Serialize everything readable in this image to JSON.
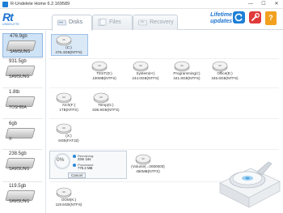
{
  "window": {
    "title": "R-Undelete Home 6.2.169589",
    "minimize": "—",
    "maximize": "☐",
    "close": "✕"
  },
  "header": {
    "logo": "R",
    "logo_sub": "UNDELETE",
    "tabs": [
      {
        "label": "Disks"
      },
      {
        "label": "Files"
      },
      {
        "label": "Recovery"
      }
    ],
    "lifetime_line1": "Lifetime",
    "lifetime_line2": "updates",
    "help": "?"
  },
  "drives": [
    {
      "size": "476.9gb",
      "name": "SAMSUNG"
    },
    {
      "size": "931.5gb",
      "name": "SAMSUNG"
    },
    {
      "size": "1.8tb",
      "name": "TOSHIBA"
    },
    {
      "size": "6gb",
      "name": "X:"
    },
    {
      "size": "238.5gb",
      "name": "SAMSUNG"
    },
    {
      "size": "119.5gb",
      "name": "SAMSUNG"
    }
  ],
  "partitions": {
    "row1": [
      {
        "line1": "(C:)",
        "line2": "476.4GB(NTFS)"
      }
    ],
    "row2": [
      {
        "line1": "TEST(D:)",
        "line2": "100MB(NTFS)"
      },
      {
        "line1": "System(H:)",
        "line2": "244.0GB(NTFS)"
      },
      {
        "line1": "Programming(I:)",
        "line2": "341.8GB(NTFS)"
      },
      {
        "line1": "Office(E:)",
        "line2": "345.6GB(NTFS)"
      }
    ],
    "row3": [
      {
        "line1": "Arch(F:)",
        "line2": "1TB(NTFS)"
      },
      {
        "line1": "Temp(G:)",
        "line2": "838.9GB(NTFS)"
      }
    ],
    "row4": [
      {
        "line1": "(X:)",
        "line2": "6GB(FAT32)"
      }
    ],
    "row5": [
      {
        "line1": "(Volume{...0000000}",
        "line2": "450MB(NTFS)"
      }
    ],
    "row6": [
      {
        "line1": "OOM(K:)",
        "line2": "119.5GB(NTFS)"
      }
    ]
  },
  "progress": {
    "percent": "0%",
    "remaining_label": "Remaining:",
    "remaining_value": "33m 16s",
    "processed_label": "Processed:",
    "processed_value": "775.2 MB",
    "cancel": "Cancel"
  },
  "colors": {
    "accent": "#1e7fd6",
    "selection": "#cfe3f7",
    "tools": "#e03a3a",
    "help": "#f2a01e"
  }
}
